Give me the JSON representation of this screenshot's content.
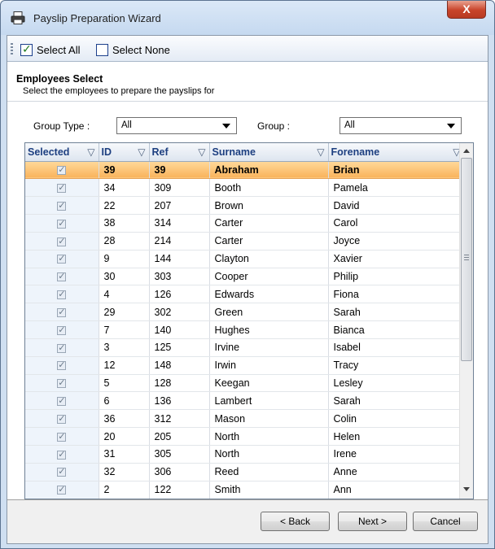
{
  "window": {
    "title": "Payslip Preparation Wizard",
    "close_label": "X"
  },
  "toolbar": {
    "select_all_label": "Select All",
    "select_none_label": "Select None"
  },
  "header": {
    "title": "Employees Select",
    "subtitle": "Select the employees to prepare the payslips for"
  },
  "filters": {
    "group_type_label": "Group Type :",
    "group_type_value": "All",
    "group_label": "Group :",
    "group_value": "All"
  },
  "grid": {
    "columns": [
      "Selected",
      "ID",
      "Ref",
      "Surname",
      "Forename"
    ],
    "rows": [
      {
        "id": "39",
        "ref": "39",
        "surname": "Abraham",
        "forename": "Brian",
        "selected": true
      },
      {
        "id": "34",
        "ref": "309",
        "surname": "Booth",
        "forename": "Pamela",
        "selected": true
      },
      {
        "id": "22",
        "ref": "207",
        "surname": "Brown",
        "forename": "David",
        "selected": true
      },
      {
        "id": "38",
        "ref": "314",
        "surname": "Carter",
        "forename": "Carol",
        "selected": true
      },
      {
        "id": "28",
        "ref": "214",
        "surname": "Carter",
        "forename": "Joyce",
        "selected": true
      },
      {
        "id": "9",
        "ref": "144",
        "surname": "Clayton",
        "forename": "Xavier",
        "selected": true
      },
      {
        "id": "30",
        "ref": "303",
        "surname": "Cooper",
        "forename": "Philip",
        "selected": true
      },
      {
        "id": "4",
        "ref": "126",
        "surname": "Edwards",
        "forename": "Fiona",
        "selected": true
      },
      {
        "id": "29",
        "ref": "302",
        "surname": "Green",
        "forename": "Sarah",
        "selected": true
      },
      {
        "id": "7",
        "ref": "140",
        "surname": "Hughes",
        "forename": "Bianca",
        "selected": true
      },
      {
        "id": "3",
        "ref": "125",
        "surname": "Irvine",
        "forename": "Isabel",
        "selected": true
      },
      {
        "id": "12",
        "ref": "148",
        "surname": "Irwin",
        "forename": "Tracy",
        "selected": true
      },
      {
        "id": "5",
        "ref": "128",
        "surname": "Keegan",
        "forename": "Lesley",
        "selected": true
      },
      {
        "id": "6",
        "ref": "136",
        "surname": "Lambert",
        "forename": "Sarah",
        "selected": true
      },
      {
        "id": "36",
        "ref": "312",
        "surname": "Mason",
        "forename": "Colin",
        "selected": true
      },
      {
        "id": "20",
        "ref": "205",
        "surname": "North",
        "forename": "Helen",
        "selected": true
      },
      {
        "id": "31",
        "ref": "305",
        "surname": "North",
        "forename": "Irene",
        "selected": true
      },
      {
        "id": "32",
        "ref": "306",
        "surname": "Reed",
        "forename": "Anne",
        "selected": true
      },
      {
        "id": "2",
        "ref": "122",
        "surname": "Smith",
        "forename": "Ann",
        "selected": true
      }
    ]
  },
  "buttons": {
    "back_label": "< Back",
    "next_label": "Next >",
    "cancel_label": "Cancel"
  },
  "colors": {
    "highlight_row": "#f9b35c",
    "header_text": "#1d3f80",
    "close_button": "#c8442a"
  }
}
